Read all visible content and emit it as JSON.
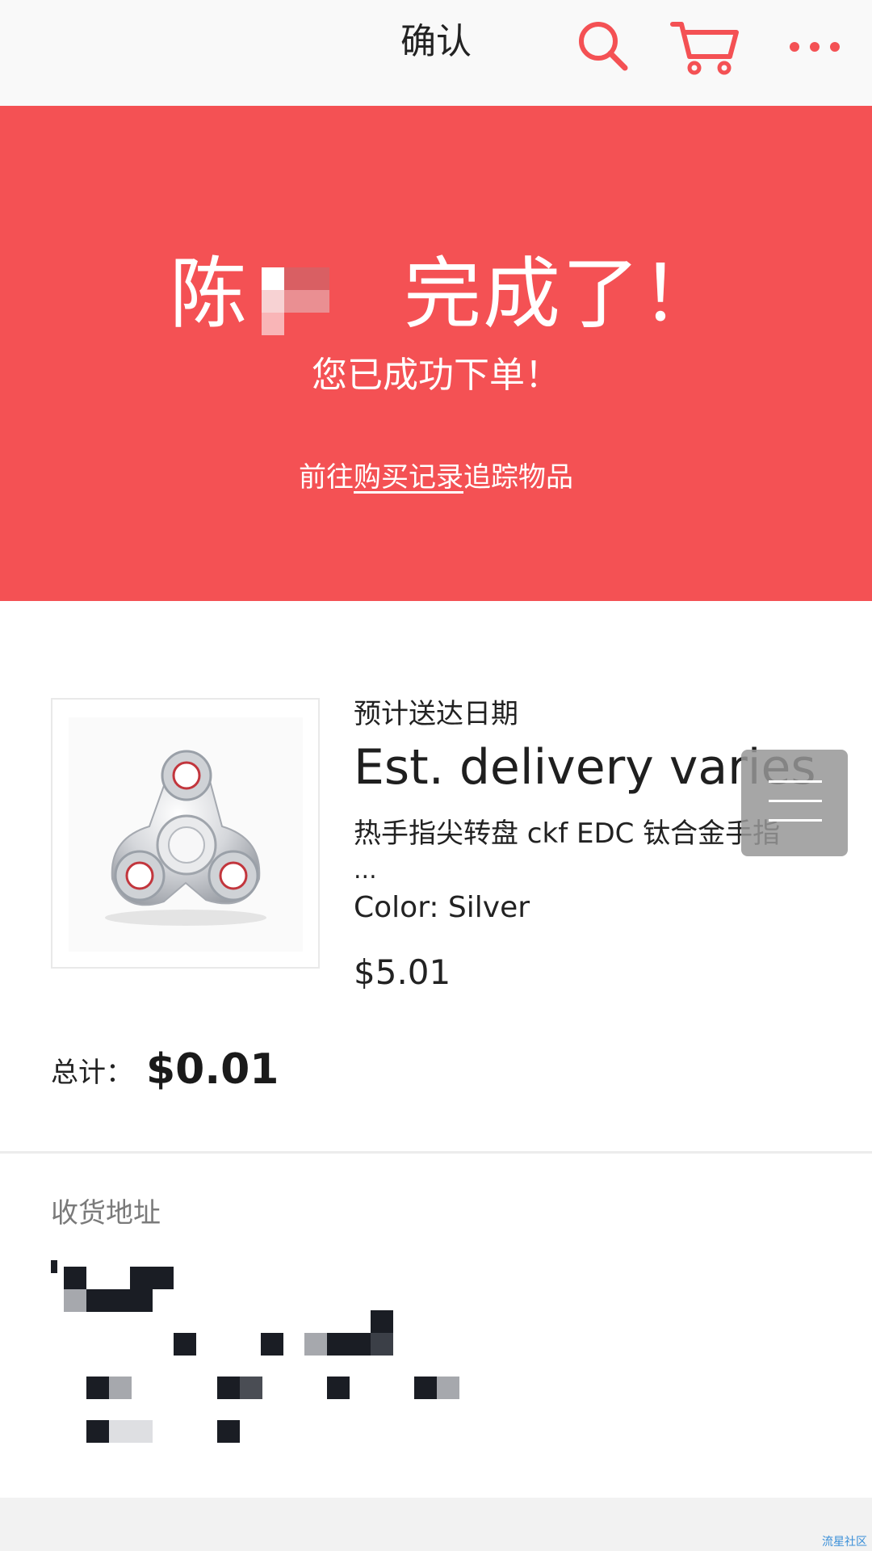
{
  "header": {
    "title": "确认",
    "icons": {
      "search": "search-icon",
      "cart": "cart-icon",
      "more": "more-icon"
    },
    "accent_color": "#f45154"
  },
  "banner": {
    "headline_name": "陈",
    "headline_suffix": "完成了！",
    "subtitle": "您已成功下单！",
    "link_prefix": "前往",
    "link_text": "购买记录",
    "link_suffix": "追踪物品",
    "background_color": "#f45154"
  },
  "product": {
    "eta_label": "预计送达日期",
    "eta_value": "Est. delivery varies",
    "title": "热手指尖转盘 ckf EDC 钛合金手指",
    "title_ellipsis": "...",
    "color": "Color: Silver",
    "price": "$5.01"
  },
  "summary": {
    "total_label": "总计：",
    "total_value": "$0.01"
  },
  "address": {
    "title": "收货地址"
  },
  "footer": {
    "watermark": "流星社区"
  }
}
